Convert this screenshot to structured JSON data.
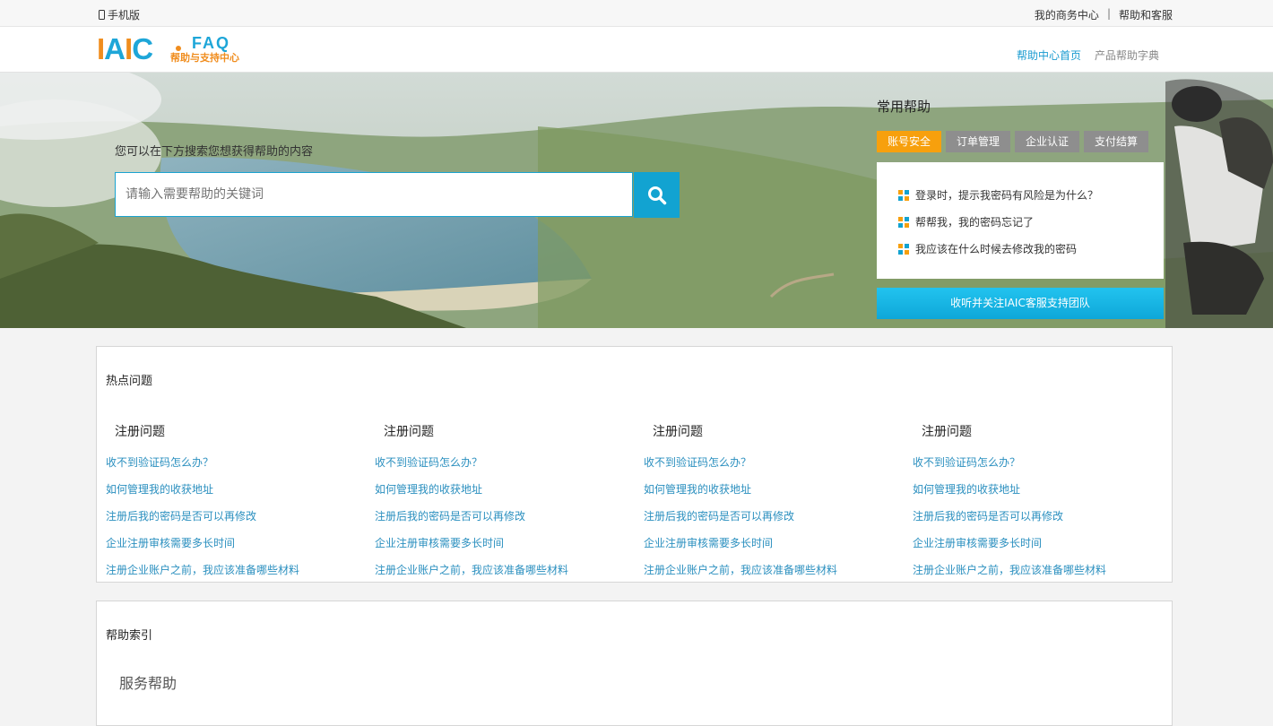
{
  "topbar": {
    "mobile": "手机版",
    "links": [
      "我的商务中心",
      "帮助和客服"
    ],
    "separator": "|"
  },
  "header": {
    "logo_main": "IAIC",
    "logo_faq": "FAQ",
    "logo_sub": "帮助与支持中心",
    "nav": [
      "帮助中心首页",
      "产品帮助字典"
    ]
  },
  "search": {
    "hint": "您可以在下方搜索您想获得帮助的内容",
    "placeholder": "请输入需要帮助的关键词"
  },
  "common_help": {
    "title": "常用帮助",
    "tabs": [
      "账号安全",
      "订单管理",
      "企业认证",
      "支付结算"
    ],
    "items": [
      "登录时，提示我密码有风险是为什么？",
      "帮帮我，我的密码忘记了",
      "我应该在什么时候去修改我的密码"
    ],
    "follow_button": "收听并关注IAIC客服支持团队"
  },
  "hot": {
    "title": "热点问题",
    "columns": [
      {
        "title": "注册问题",
        "questions": [
          "收不到验证码怎么办？",
          "如何管理我的收获地址",
          "注册后我的密码是否可以再修改",
          "企业注册审核需要多长时间",
          "注册企业账户之前，我应该准备哪些材料"
        ]
      },
      {
        "title": "注册问题",
        "questions": [
          "收不到验证码怎么办？",
          "如何管理我的收获地址",
          "注册后我的密码是否可以再修改",
          "企业注册审核需要多长时间",
          "注册企业账户之前，我应该准备哪些材料"
        ]
      },
      {
        "title": "注册问题",
        "questions": [
          "收不到验证码怎么办？",
          "如何管理我的收获地址",
          "注册后我的密码是否可以再修改",
          "企业注册审核需要多长时间",
          "注册企业账户之前，我应该准备哪些材料"
        ]
      },
      {
        "title": "注册问题",
        "questions": [
          "收不到验证码怎么办？",
          "如何管理我的收获地址",
          "注册后我的密码是否可以再修改",
          "企业注册审核需要多长时间",
          "注册企业账户之前，我应该准备哪些材料"
        ]
      }
    ]
  },
  "index": {
    "title": "帮助索引",
    "subtitle": "服务帮助"
  },
  "colors": {
    "accent_blue": "#12a3d1",
    "accent_orange": "#f7a00d",
    "link_blue": "#2a8fbf",
    "tab_grey": "#8e8e8e"
  }
}
